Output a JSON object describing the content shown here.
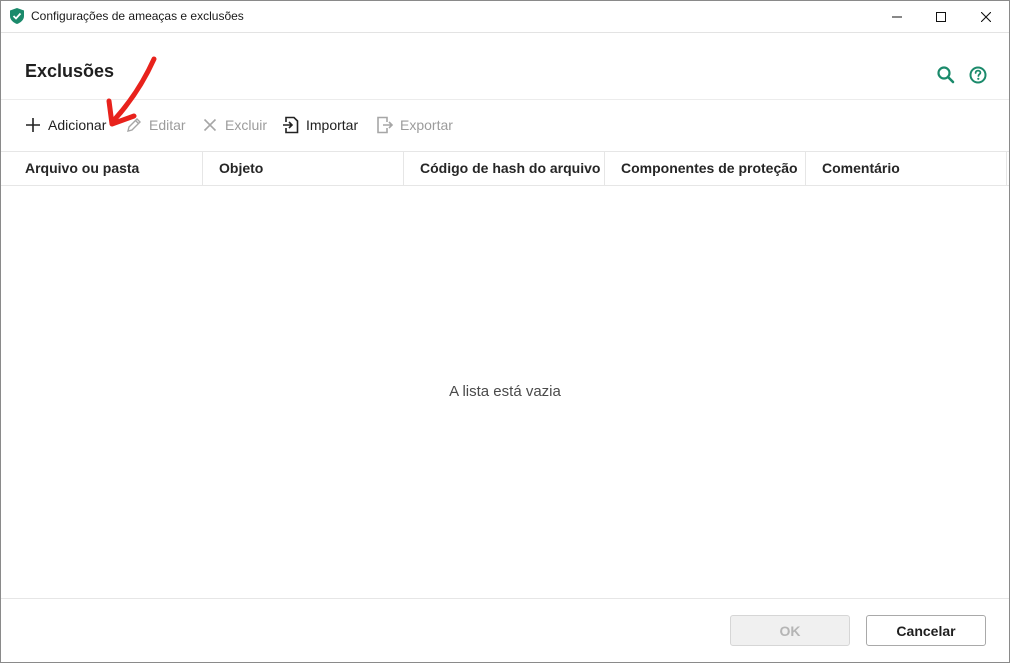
{
  "window": {
    "title": "Configurações de ameaças e exclusões"
  },
  "header": {
    "title": "Exclusões",
    "icons": [
      "search-icon",
      "help-icon"
    ]
  },
  "toolbar": {
    "add_label": "Adicionar",
    "edit_label": "Editar",
    "delete_label": "Excluir",
    "import_label": "Importar",
    "export_label": "Exportar"
  },
  "table": {
    "columns": [
      "Arquivo ou pasta",
      "Objeto",
      "Código de hash do arquivo",
      "Componentes de proteção",
      "Comentário"
    ],
    "rows": [],
    "empty_message": "A lista está vazia"
  },
  "footer": {
    "ok_label": "OK",
    "cancel_label": "Cancelar"
  },
  "colors": {
    "accent": "#1b8a6b",
    "annotation": "#e8221c",
    "disabled_text": "#9c9c9c"
  }
}
